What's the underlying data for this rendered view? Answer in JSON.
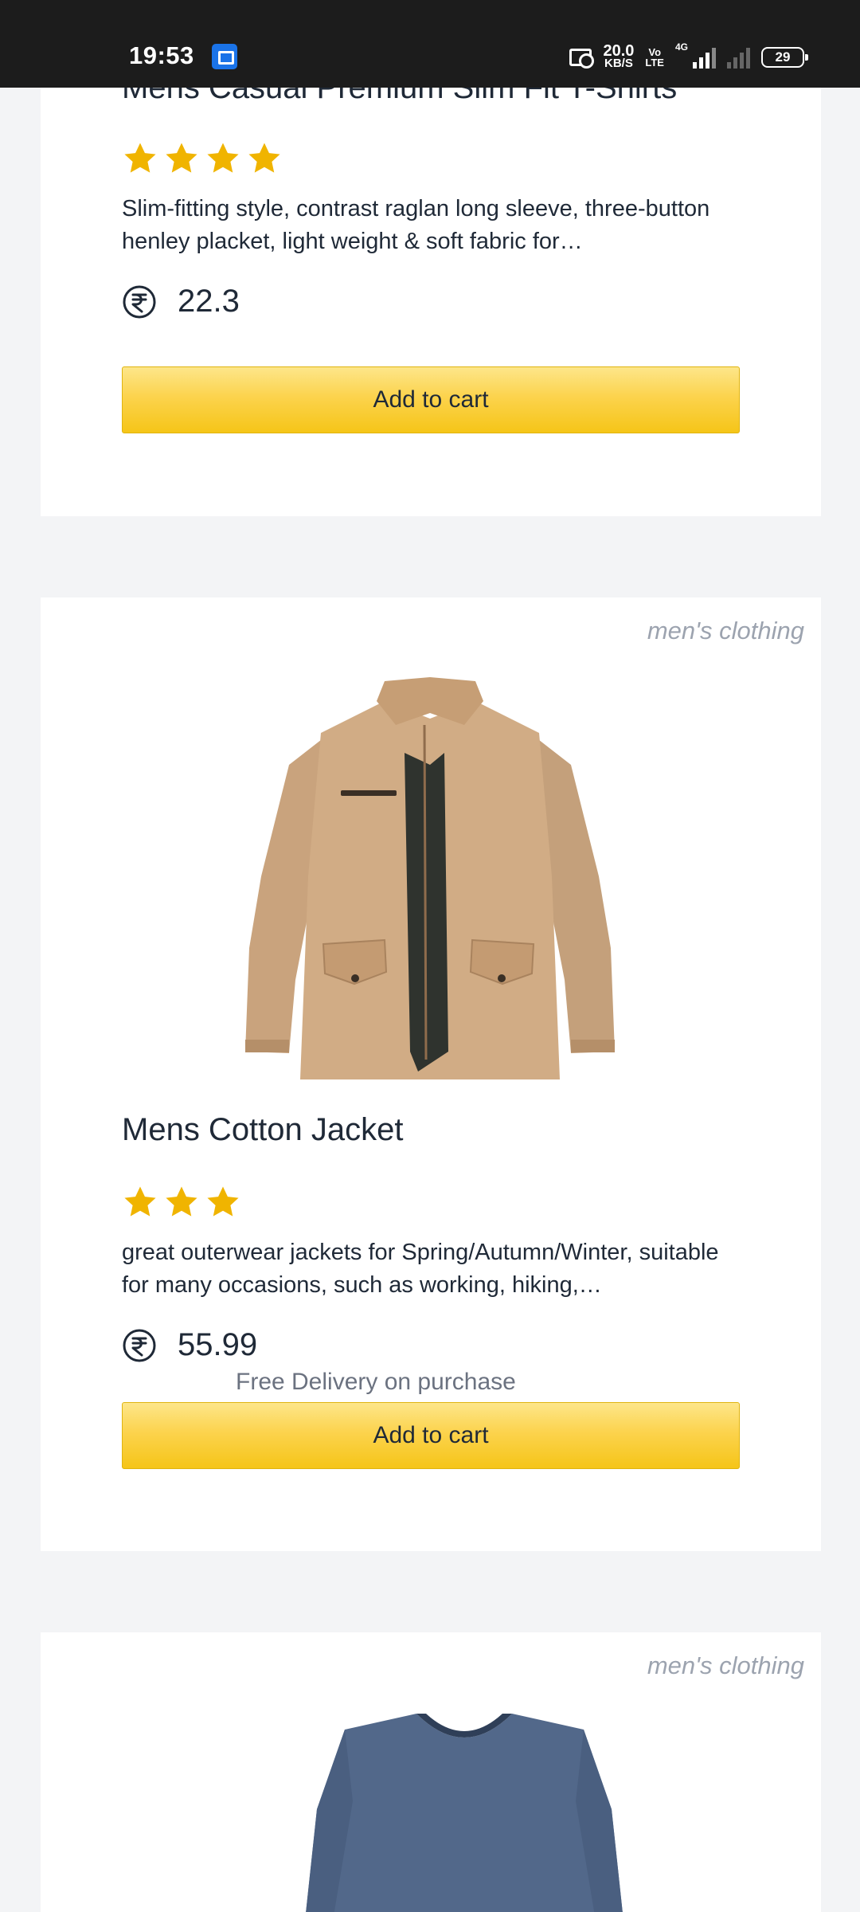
{
  "status_bar": {
    "time": "19:53",
    "net_speed_value": "20.0",
    "net_speed_unit": "KB/S",
    "volte_top": "Vo",
    "volte_bottom": "LTE",
    "network_type": "4G",
    "battery": "29"
  },
  "products": [
    {
      "title": "Mens Casual Premium Slim Fit T-Shirts",
      "rating_stars": 4,
      "description": "Slim-fitting style, contrast raglan long sleeve, three-button henley placket, light weight & soft fabric for…",
      "price": "22.3",
      "add_to_cart_label": "Add to cart"
    },
    {
      "category": "men's clothing",
      "title": "Mens Cotton Jacket",
      "rating_stars": 3,
      "description": "great outerwear jackets for Spring/Autumn/Winter, suitable for many occasions, such as working, hiking,…",
      "price": "55.99",
      "delivery_note": "Free Delivery on purchase",
      "add_to_cart_label": "Add to cart"
    },
    {
      "category": "men's clothing"
    }
  ],
  "colors": {
    "star": "#f0b400",
    "button_top": "#fde68a",
    "button_bottom": "#f5c518",
    "category_text": "#9ca3af",
    "page_bg": "#f3f4f6"
  }
}
